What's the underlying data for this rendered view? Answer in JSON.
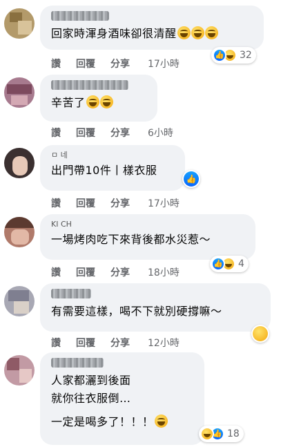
{
  "actions": {
    "like": "讚",
    "reply": "回覆",
    "share": "分享"
  },
  "comments": [
    {
      "text": "回家時渾身酒味卻很清醒",
      "time": "17小時",
      "reaction_count": "32"
    },
    {
      "text": "辛苦了",
      "time": "6小時"
    },
    {
      "name_fragment": "ㅁ 네",
      "text": "出門帶10件丨樣衣服",
      "time": "17小時"
    },
    {
      "name_fragment": "KI CH",
      "text": "一場烤肉吃下來背後都水災惹～",
      "time": "18小時",
      "reaction_count": "4"
    },
    {
      "text": "有需要這樣，喝不下就別硬撐嘛～",
      "time": "12小時"
    },
    {
      "text_line1": "人家都灑到後面",
      "text_line2": "就你往衣服倒…",
      "text_line3": "一定是喝多了！！！",
      "time": "",
      "reaction_count": "18"
    }
  ],
  "colors": {
    "bubble": "#f0f2f5",
    "meta": "#65676b",
    "like_blue": "#0866ff",
    "haha_yellow": "#f7b928"
  },
  "icons": {
    "like": "thumbs-up-icon",
    "haha": "laughing-face-icon"
  }
}
